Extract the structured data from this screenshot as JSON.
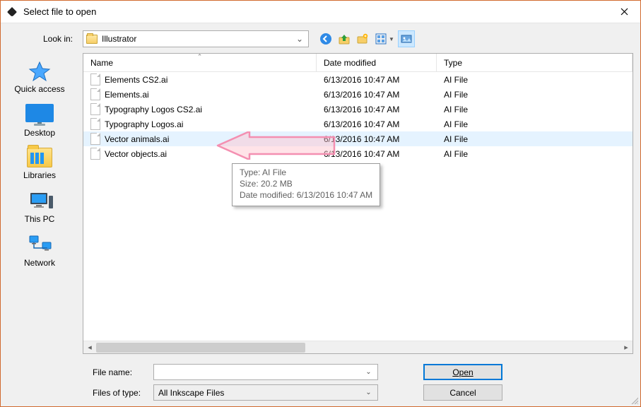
{
  "title": "Select file to open",
  "lookin": {
    "label": "Look in:",
    "value": "Illustrator"
  },
  "places": [
    {
      "key": "quick-access",
      "label": "Quick access"
    },
    {
      "key": "desktop",
      "label": "Desktop"
    },
    {
      "key": "libraries",
      "label": "Libraries"
    },
    {
      "key": "this-pc",
      "label": "This PC"
    },
    {
      "key": "network",
      "label": "Network"
    }
  ],
  "columns": {
    "name": "Name",
    "date": "Date modified",
    "type": "Type"
  },
  "files": [
    {
      "name": "Elements CS2.ai",
      "date": "6/13/2016 10:47 AM",
      "type": "AI File"
    },
    {
      "name": "Elements.ai",
      "date": "6/13/2016 10:47 AM",
      "type": "AI File"
    },
    {
      "name": "Typography Logos CS2.ai",
      "date": "6/13/2016 10:47 AM",
      "type": "AI File"
    },
    {
      "name": "Typography Logos.ai",
      "date": "6/13/2016 10:47 AM",
      "type": "AI File"
    },
    {
      "name": "Vector animals.ai",
      "date": "6/13/2016 10:47 AM",
      "type": "AI File"
    },
    {
      "name": "Vector objects.ai",
      "date": "6/13/2016 10:47 AM",
      "type": "AI File"
    }
  ],
  "selected_index": 4,
  "tooltip": {
    "line1": "Type: AI File",
    "line2": "Size: 20.2 MB",
    "line3": "Date modified: 6/13/2016 10:47 AM"
  },
  "form": {
    "filename_label": "File name:",
    "filename_value": "",
    "filetype_label": "Files of type:",
    "filetype_value": "All Inkscape Files"
  },
  "buttons": {
    "open": "Open",
    "cancel": "Cancel"
  }
}
